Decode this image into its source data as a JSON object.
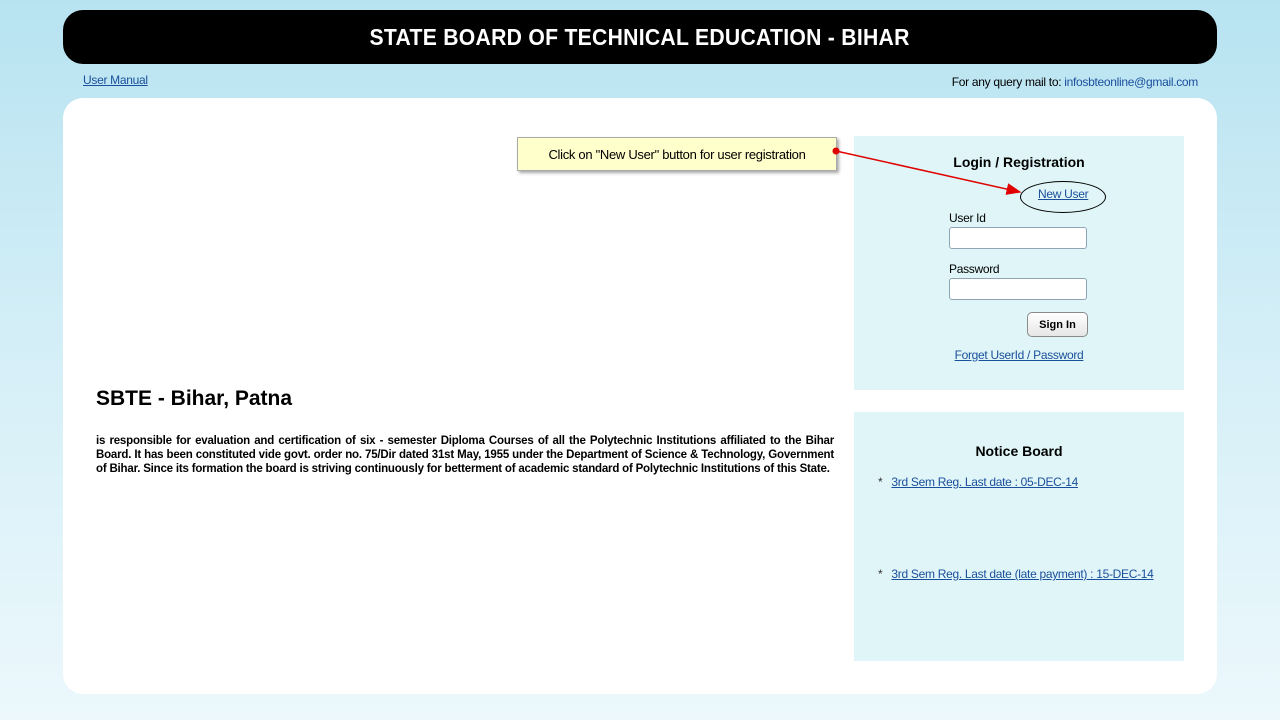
{
  "header": {
    "title": "STATE BOARD OF TECHNICAL EDUCATION - BIHAR"
  },
  "top_bar": {
    "user_manual": "User Manual",
    "query_prefix": "For any query mail to:",
    "query_email": "infosbteonline@gmail.com"
  },
  "tooltip": {
    "text": "Click on \"New User\" button for user registration"
  },
  "login": {
    "title": "Login / Registration",
    "new_user": "New User",
    "user_id_label": "User Id",
    "user_id_value": "",
    "password_label": "Password",
    "password_value": "",
    "sign_in": "Sign In",
    "forget": "Forget UserId / Password"
  },
  "intro": {
    "title": "SBTE - Bihar, Patna",
    "text": "is responsible for evaluation and certification of six - semester Diploma Courses of all the Polytechnic Institutions affiliated to the Bihar Board. It has been constituted vide govt. order no. 75/Dir dated 31st May, 1955 under the Department of Science & Technology, Government of Bihar. Since its formation the board is striving continuously for betterment of academic standard of Polytechnic Institutions of this State."
  },
  "notice_board": {
    "title": "Notice Board",
    "items": [
      {
        "bullet": "*",
        "label": "3rd Sem Reg. Last date : 05-DEC-14"
      },
      {
        "bullet": "*",
        "label": "3rd Sem Reg. Last date (late payment) : 15-DEC-14"
      }
    ]
  },
  "colors": {
    "link": "#1a4f9c",
    "panel": "#dff5f7",
    "tooltip": "#ffffcc",
    "annotation": "#e00000"
  }
}
